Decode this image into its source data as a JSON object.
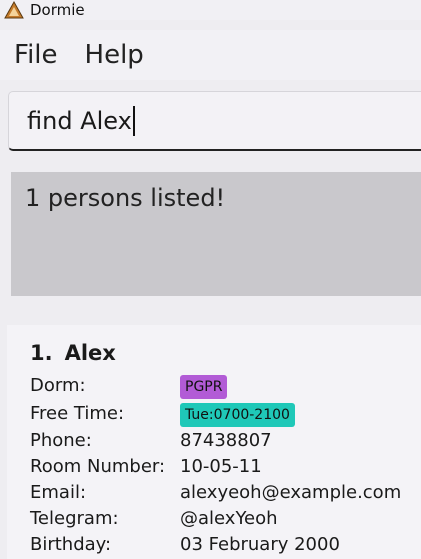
{
  "window": {
    "title": "Dormie"
  },
  "menu": {
    "items": [
      "File",
      "Help"
    ]
  },
  "command": {
    "value": "find Alex"
  },
  "result": {
    "message": "1 persons listed!"
  },
  "persons": [
    {
      "index": "1.",
      "name": "Alex",
      "fields": {
        "dorm_label": "Dorm:",
        "dorm_tag": "PGPR",
        "dorm_tag_color": "#b25bd6",
        "freetime_label": "Free Time:",
        "freetime_tag": "Tue:0700-2100",
        "freetime_tag_color": "#1fc8b8",
        "phone_label": "Phone:",
        "phone": "87438807",
        "room_label": "Room Number:",
        "room": "10-05-11",
        "email_label": "Email:",
        "email": "alexyeoh@example.com",
        "telegram_label": "Telegram:",
        "telegram": "@alexYeoh",
        "birthday_label": "Birthday:",
        "birthday": "03 February 2000"
      }
    }
  ]
}
